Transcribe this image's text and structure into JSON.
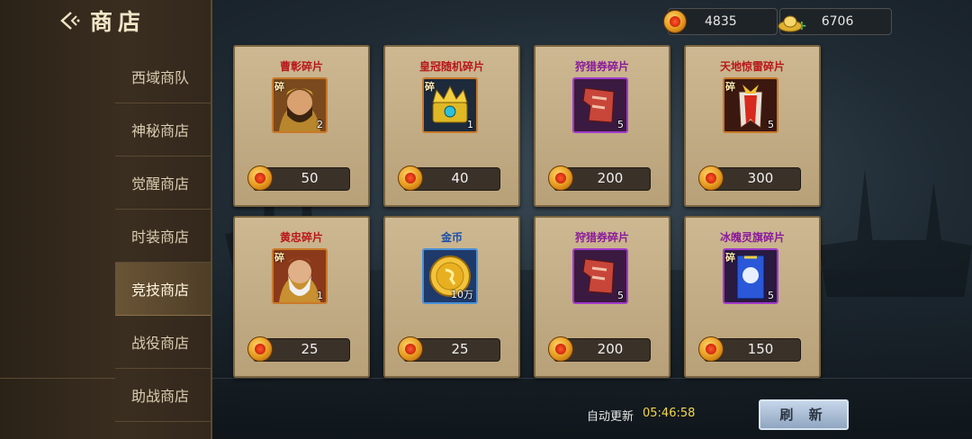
{
  "header": {
    "title": "商店"
  },
  "sidebar": {
    "items": [
      {
        "label": "西域商队",
        "active": false
      },
      {
        "label": "神秘商店",
        "active": false
      },
      {
        "label": "觉醒商店",
        "active": false
      },
      {
        "label": "时装商店",
        "active": false
      },
      {
        "label": "竞技商店",
        "active": true
      },
      {
        "label": "战役商店",
        "active": false
      },
      {
        "label": "助战商店",
        "active": false
      }
    ]
  },
  "currency": {
    "coins": "4835",
    "ingots": "6706"
  },
  "items": [
    {
      "name": "曹彰碎片",
      "name_color": "#b8181a",
      "frag": "碎",
      "qty": "2",
      "price": "50",
      "frame": "orange",
      "icon": "hero-caozhang-portrait"
    },
    {
      "name": "皇冠随机碎片",
      "name_color": "#b8181a",
      "frag": "碎",
      "qty": "1",
      "price": "40",
      "frame": "orange",
      "icon": "crown-chest-icon"
    },
    {
      "name": "狩猎券碎片",
      "name_color": "#8a1a9a",
      "frag": "",
      "qty": "5",
      "price": "200",
      "frame": "purple",
      "icon": "hunting-ticket-icon"
    },
    {
      "name": "天地惊雷碎片",
      "name_color": "#b8181a",
      "frag": "碎",
      "qty": "5",
      "price": "300",
      "frame": "orange",
      "icon": "thunder-banner-icon"
    },
    {
      "name": "黄忠碎片",
      "name_color": "#b8181a",
      "frag": "碎",
      "qty": "1",
      "price": "25",
      "frame": "orange",
      "icon": "hero-huangzhong-portrait"
    },
    {
      "name": "金币",
      "name_color": "#1a4fa8",
      "frag": "",
      "qty": "10万",
      "price": "25",
      "frame": "blue",
      "icon": "gold-coin-icon"
    },
    {
      "name": "狩猎券碎片",
      "name_color": "#8a1a9a",
      "frag": "",
      "qty": "5",
      "price": "200",
      "frame": "purple",
      "icon": "hunting-ticket-icon"
    },
    {
      "name": "冰魄灵旗碎片",
      "name_color": "#8a1a9a",
      "frag": "碎",
      "qty": "5",
      "price": "150",
      "frame": "purple",
      "icon": "ice-flag-icon"
    }
  ],
  "footer": {
    "auto_refresh_label": "自动更新",
    "auto_refresh_time": "05:46:58",
    "refresh_button": "刷 新"
  }
}
